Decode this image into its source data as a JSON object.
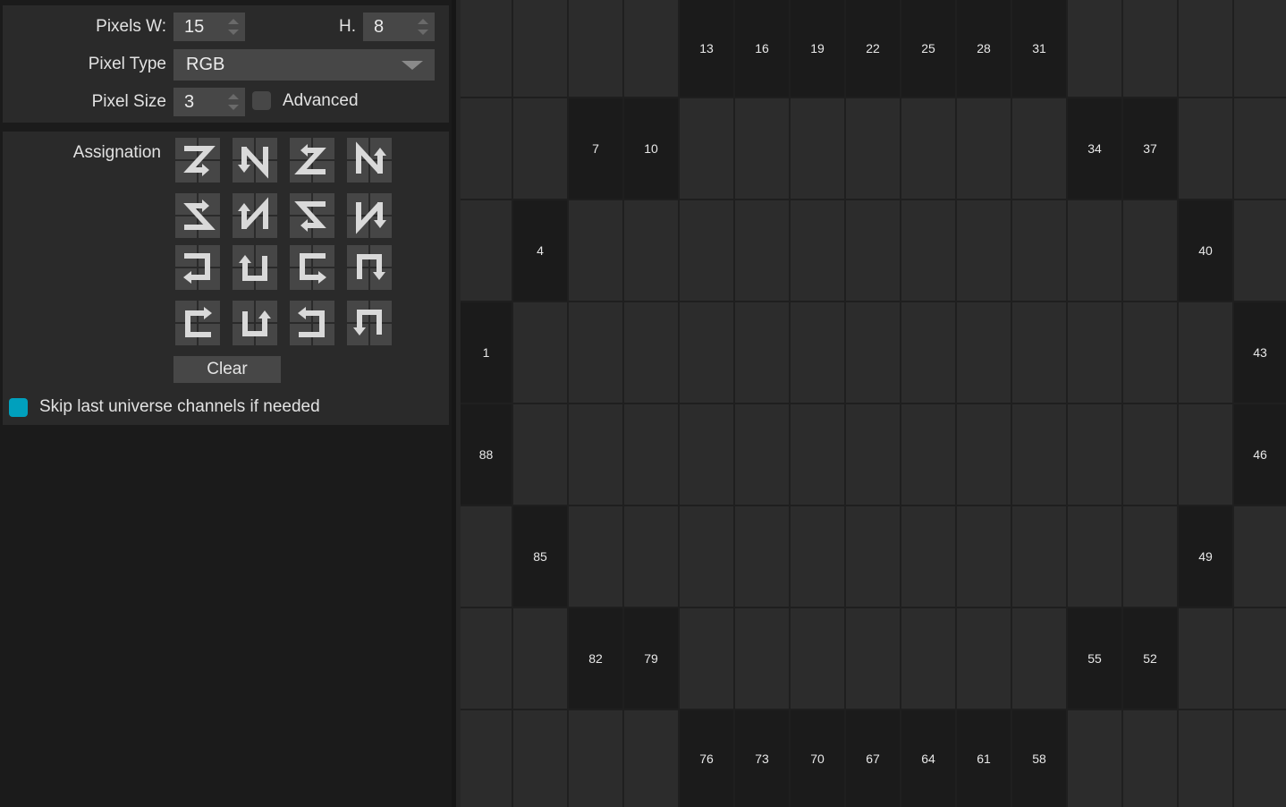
{
  "settings": {
    "pixels_w_label": "Pixels W:",
    "pixels_w_value": "15",
    "pixels_h_label": "H.",
    "pixels_h_value": "8",
    "pixel_type_label": "Pixel Type",
    "pixel_type_value": "RGB",
    "pixel_size_label": "Pixel Size",
    "pixel_size_value": "3",
    "advanced_label": "Advanced",
    "advanced_checked": false
  },
  "assignation": {
    "label": "Assignation",
    "patterns": [
      "zigzag-right-down",
      "zigzag-down-right",
      "zigzag-left-down",
      "zigzag-up-right",
      "zigzag-left-up",
      "zigzag-up-left",
      "zigzag-right-up",
      "zigzag-down-left",
      "snake-left-down",
      "snake-up-right",
      "snake-right-down",
      "snake-down-right",
      "snake-right-up",
      "snake-down-left",
      "snake-left-up",
      "snake-up-left"
    ],
    "clear_label": "Clear"
  },
  "skip": {
    "label": "Skip last universe channels if needed",
    "checked": true,
    "color": "#00a0bd"
  },
  "grid": {
    "columns": 15,
    "rows": 8,
    "assigned": [
      {
        "row": 0,
        "col": 4,
        "channel": "13"
      },
      {
        "row": 0,
        "col": 5,
        "channel": "16"
      },
      {
        "row": 0,
        "col": 6,
        "channel": "19"
      },
      {
        "row": 0,
        "col": 7,
        "channel": "22"
      },
      {
        "row": 0,
        "col": 8,
        "channel": "25"
      },
      {
        "row": 0,
        "col": 9,
        "channel": "28"
      },
      {
        "row": 0,
        "col": 10,
        "channel": "31"
      },
      {
        "row": 1,
        "col": 2,
        "channel": "7"
      },
      {
        "row": 1,
        "col": 3,
        "channel": "10"
      },
      {
        "row": 1,
        "col": 11,
        "channel": "34"
      },
      {
        "row": 1,
        "col": 12,
        "channel": "37"
      },
      {
        "row": 2,
        "col": 1,
        "channel": "4"
      },
      {
        "row": 2,
        "col": 13,
        "channel": "40"
      },
      {
        "row": 3,
        "col": 0,
        "channel": "1"
      },
      {
        "row": 3,
        "col": 14,
        "channel": "43"
      },
      {
        "row": 4,
        "col": 0,
        "channel": "88"
      },
      {
        "row": 4,
        "col": 14,
        "channel": "46"
      },
      {
        "row": 5,
        "col": 1,
        "channel": "85"
      },
      {
        "row": 5,
        "col": 13,
        "channel": "49"
      },
      {
        "row": 6,
        "col": 2,
        "channel": "82"
      },
      {
        "row": 6,
        "col": 3,
        "channel": "79"
      },
      {
        "row": 6,
        "col": 11,
        "channel": "55"
      },
      {
        "row": 6,
        "col": 12,
        "channel": "52"
      },
      {
        "row": 7,
        "col": 4,
        "channel": "76"
      },
      {
        "row": 7,
        "col": 5,
        "channel": "73"
      },
      {
        "row": 7,
        "col": 6,
        "channel": "70"
      },
      {
        "row": 7,
        "col": 7,
        "channel": "67"
      },
      {
        "row": 7,
        "col": 8,
        "channel": "64"
      },
      {
        "row": 7,
        "col": 9,
        "channel": "61"
      },
      {
        "row": 7,
        "col": 10,
        "channel": "58"
      }
    ]
  }
}
